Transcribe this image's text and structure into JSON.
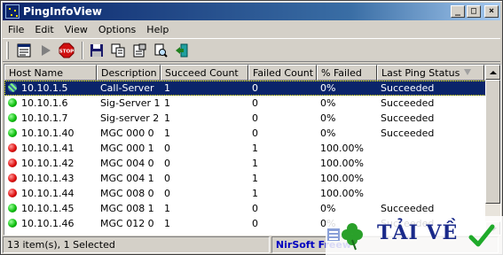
{
  "window": {
    "title": "PingInfoView"
  },
  "menu": [
    "File",
    "Edit",
    "View",
    "Options",
    "Help"
  ],
  "toolbar": {
    "buttons": [
      "properties-icon",
      "play-icon",
      "stop-icon",
      "save-icon",
      "copy-icon",
      "html-report-icon",
      "find-icon",
      "exit-icon"
    ]
  },
  "columns": [
    "Host Name",
    "Description",
    "Succeed Count",
    "Failed Count",
    "% Failed",
    "Last Ping Status"
  ],
  "rows": [
    {
      "host": "10.10.1.5",
      "desc": "Call-Server",
      "succeed": "1",
      "failed": "0",
      "pct": "0%",
      "status": "Succeeded",
      "state": "selected"
    },
    {
      "host": "10.10.1.6",
      "desc": "Sig-Server 1",
      "succeed": "1",
      "failed": "0",
      "pct": "0%",
      "status": "Succeeded",
      "state": "up"
    },
    {
      "host": "10.10.1.7",
      "desc": "Sig-server 2",
      "succeed": "1",
      "failed": "0",
      "pct": "0%",
      "status": "Succeeded",
      "state": "up"
    },
    {
      "host": "10.10.1.40",
      "desc": "MGC 000 0",
      "succeed": "1",
      "failed": "0",
      "pct": "0%",
      "status": "Succeeded",
      "state": "up"
    },
    {
      "host": "10.10.1.41",
      "desc": "MGC 000 1",
      "succeed": "0",
      "failed": "1",
      "pct": "100.00%",
      "status": "",
      "state": "down"
    },
    {
      "host": "10.10.1.42",
      "desc": "MGC 004 0",
      "succeed": "0",
      "failed": "1",
      "pct": "100.00%",
      "status": "",
      "state": "down"
    },
    {
      "host": "10.10.1.43",
      "desc": "MGC 004 1",
      "succeed": "0",
      "failed": "1",
      "pct": "100.00%",
      "status": "",
      "state": "down"
    },
    {
      "host": "10.10.1.44",
      "desc": "MGC 008 0",
      "succeed": "0",
      "failed": "1",
      "pct": "100.00%",
      "status": "",
      "state": "down"
    },
    {
      "host": "10.10.1.45",
      "desc": "MGC 008 1",
      "succeed": "1",
      "failed": "0",
      "pct": "0%",
      "status": "Succeeded",
      "state": "up"
    },
    {
      "host": "10.10.1.46",
      "desc": "MGC 012 0",
      "succeed": "1",
      "failed": "0",
      "pct": "0%",
      "status": "Succeeded",
      "state": "up"
    }
  ],
  "status": {
    "items": "13 item(s), 1 Selected",
    "credit": "NirSoft Freew"
  },
  "watermark": {
    "text": "TẢI VỀ"
  },
  "colors": {
    "titlebar": "#0a246a",
    "selection": "#0a246a",
    "up": "#10c010",
    "down": "#e01010"
  }
}
